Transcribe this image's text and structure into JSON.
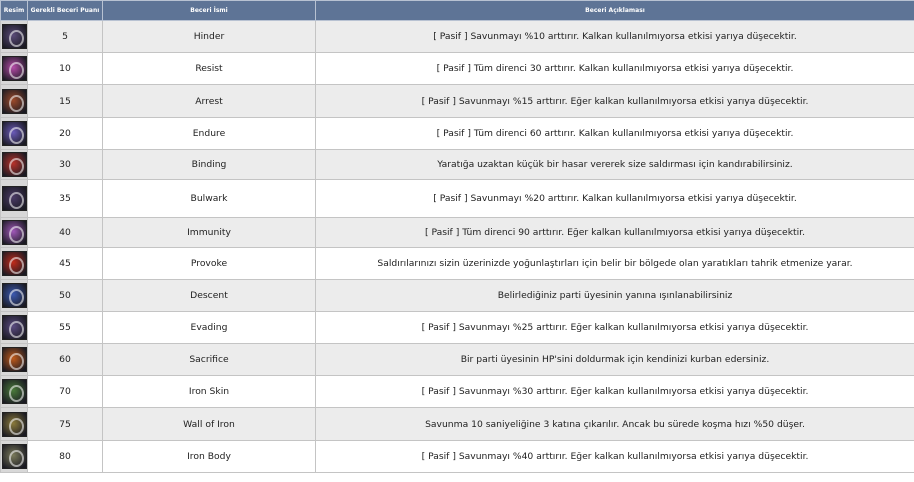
{
  "headers": {
    "image": "Resim",
    "points": "Gerekli Beceri Puanı",
    "name": "Beceri İsmi",
    "desc": "Beceri Açıklaması"
  },
  "rows": [
    {
      "points": "5",
      "name": "Hinder",
      "desc": "[ Pasif ] Savunmayı %10 arttırır. Kalkan kullanılmıyorsa etkisi yarıya düşecektir.",
      "icon": "shield-purple-icon",
      "color": "#5a4a78"
    },
    {
      "points": "10",
      "name": "Resist",
      "desc": "[ Pasif ] Tüm direnci 30 arttırır. Kalkan kullanılmıyorsa etkisi yarıya düşecektir.",
      "icon": "resist-ring-icon",
      "color": "#b54aa8"
    },
    {
      "points": "15",
      "name": "Arrest",
      "desc": "[ Pasif ] Savunmayı %15 arttırır. Eğer kalkan kullanılmıyorsa etkisi yarıya düşecektir.",
      "icon": "armor-arrest-icon",
      "color": "#9c4a2a"
    },
    {
      "points": "20",
      "name": "Endure",
      "desc": "[ Pasif ] Tüm direnci 60 arttırır. Kalkan kullanılmıyorsa etkisi yarıya düşecektir.",
      "icon": "endure-ring-icon",
      "color": "#6a5ab8"
    },
    {
      "points": "30",
      "name": "Binding",
      "desc": "Yaratığa uzaktan küçük bir hasar vererek size saldırması için kandırabilirsiniz.",
      "icon": "dragon-binding-icon",
      "color": "#b8322a"
    },
    {
      "points": "35",
      "name": "Bulwark",
      "desc": "[ Pasif ] Savunmayı %20 arttırır. Kalkan kullanılmıyorsa etkisi yarıya düşecektir.",
      "icon": "shield-bulwark-icon",
      "color": "#4a3a66"
    },
    {
      "points": "40",
      "name": "Immunity",
      "desc": "[ Pasif ] Tüm direnci 90 arttırır. Eğer kalkan kullanılmıyorsa etkisi yarıya düşecektir.",
      "icon": "immunity-ring-icon",
      "color": "#a058b8"
    },
    {
      "points": "45",
      "name": "Provoke",
      "desc": "Saldırılarınızı sizin üzerinizde yoğunlaştırları için belir bir bölgede olan yaratıkları tahrik etmenize yarar.",
      "icon": "dragon-provoke-icon",
      "color": "#c02a1a"
    },
    {
      "points": "50",
      "name": "Descent",
      "desc": "Belirlediğiniz parti üyesinin yanına ışınlanabilirsiniz",
      "icon": "descent-portal-icon",
      "color": "#3a58b0"
    },
    {
      "points": "55",
      "name": "Evading",
      "desc": "[ Pasif ] Savunmayı  %25 arttırır. Eğer kalkan kullanılmıyorsa etkisi yarıya düşecektir.",
      "icon": "shield-evading-icon",
      "color": "#5a4a80"
    },
    {
      "points": "60",
      "name": "Sacrifice",
      "desc": "Bir parti üyesinin HP'sini doldurmak için kendinizi kurban edersiniz.",
      "icon": "sacrifice-icon",
      "color": "#c05a1a"
    },
    {
      "points": "70",
      "name": "Iron Skin",
      "desc": "[ Pasif ] Savunmayı  %30 arttırır. Eğer kalkan kullanılmıyorsa etkisi yarıya düşecektir.",
      "icon": "iron-skin-icon",
      "color": "#4a7a3a"
    },
    {
      "points": "75",
      "name": "Wall of Iron",
      "desc": "Savunma 10 saniyeliğine 3 katına çıkarılır. Ancak bu sürede koşma hızı %50 düşer.",
      "icon": "wall-of-iron-icon",
      "color": "#8a7a3a"
    },
    {
      "points": "80",
      "name": "Iron Body",
      "desc": "[ Pasif ] Savunmayı  %40 arttırır. Eğer kalkan kullanılmıyorsa etkisi yarıya düşecektir.",
      "icon": "iron-body-icon",
      "color": "#7a7a5a"
    }
  ]
}
